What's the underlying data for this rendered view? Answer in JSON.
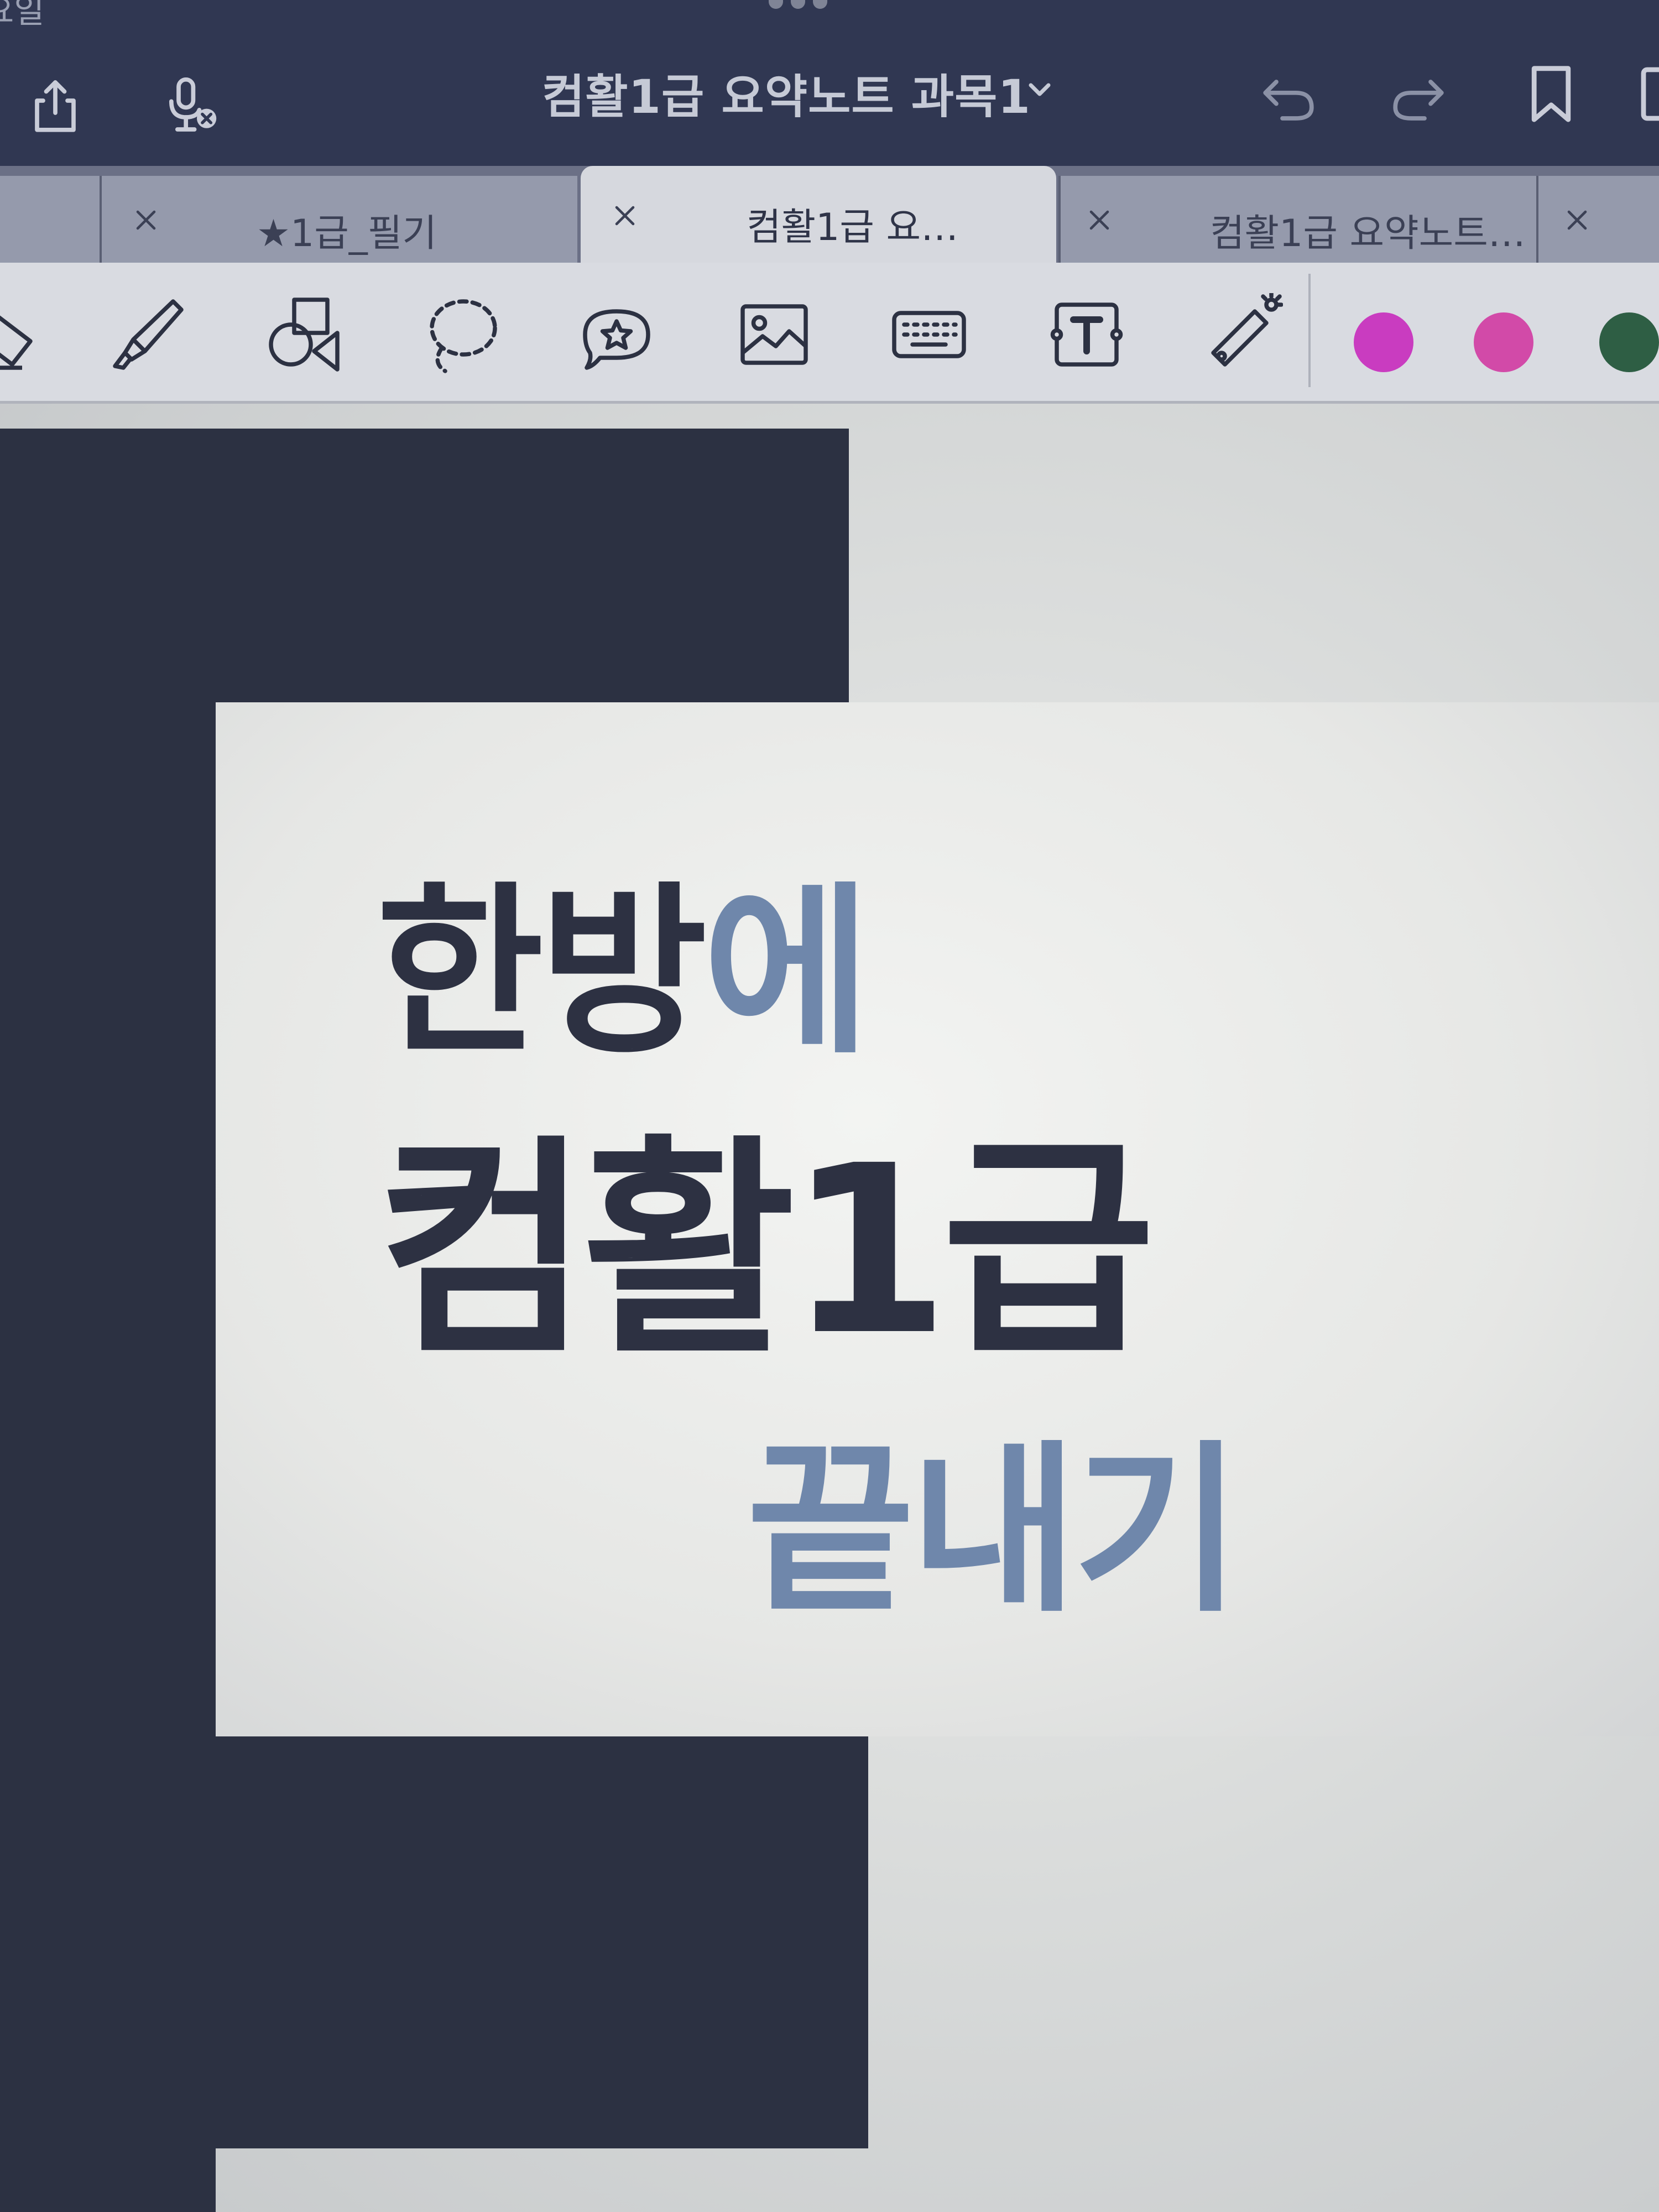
{
  "status_bar": {
    "partial_text": "요일"
  },
  "title_bar": {
    "document_title": "컴활1급 요약노트 과목1",
    "left_icons": [
      "share-icon",
      "microphone-off-icon"
    ],
    "right_icons": [
      "undo-icon",
      "redo-icon",
      "bookmark-icon"
    ]
  },
  "tabs": [
    {
      "label": "★1급_필기",
      "active": false
    },
    {
      "label": "컴활1급 요…",
      "active": true
    },
    {
      "label": "컴활1급 요약노트…",
      "active": false
    }
  ],
  "toolbar": {
    "tools": [
      "eraser-icon",
      "highlighter-icon",
      "shapes-icon",
      "lasso-icon",
      "sticker-icon",
      "image-icon",
      "keyboard-icon",
      "text-box-icon",
      "laser-pointer-icon"
    ],
    "colors": [
      "#c93cc0",
      "#d24aa8",
      "#2e5e44"
    ]
  },
  "cover": {
    "line1_dark": "한방",
    "line1_accent": "에",
    "line2": "컴활1급",
    "line3": "끝내기",
    "colors": {
      "navy": "#2c3142",
      "accent": "#6f87ab"
    }
  }
}
